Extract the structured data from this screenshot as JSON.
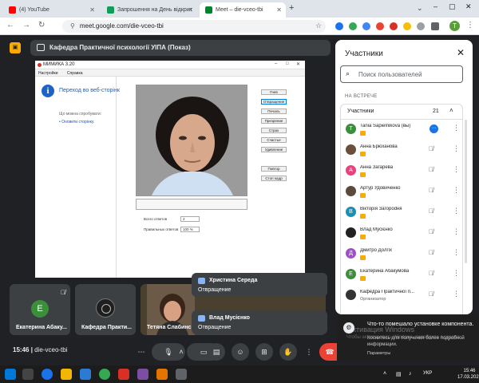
{
  "browser": {
    "tabs": [
      {
        "title": "(4) YouTube",
        "favicon_color": "#ff0000",
        "active": false
      },
      {
        "title": "Запрошення на День відкрит",
        "favicon_color": "#0f9d58",
        "active": false
      },
      {
        "title": "Meet – die-vceo-tbi",
        "favicon_color": "#00832d",
        "active": true
      }
    ],
    "url": "meet.google.com/die-vceo-tbi",
    "profile_initial": "T"
  },
  "meet": {
    "presenter_label": "Кафедра Практичної психології УІПА (Показ)",
    "meeting_code": "die-vceo-tbi",
    "time": "15:46",
    "controls": [
      "more-options",
      "mic",
      "chevron-up",
      "camera",
      "captions",
      "emoji",
      "present",
      "raise-hand",
      "more",
      "leave-call"
    ]
  },
  "shared_window": {
    "title": "МИМИКА 3.20",
    "menu": [
      "Настройки",
      "Справка"
    ],
    "error_title": "Переход во веб-сторінк",
    "error_try": "Що можна спробувати:",
    "error_refresh": "Оновити сторінку.",
    "buttons": [
      "Гнев",
      "Отвращение",
      "Печаль",
      "Презрение",
      "Страх",
      "Счастье",
      "Удивление",
      "Повтор",
      "Стоп кадр"
    ],
    "selected_button": "Отвращение",
    "stats": [
      {
        "label": "Всего ответов",
        "value": "2"
      },
      {
        "label": "Правильных ответов",
        "value": "100 %"
      }
    ]
  },
  "tiles": [
    {
      "name": "Екатерина Абаку...",
      "letter": "Е",
      "color": "#3c8f3a",
      "muted": true
    },
    {
      "name": "Кафедра Практи...",
      "emblem": true
    },
    {
      "name": "Тетяна Слабинсь...",
      "photo": true
    }
  ],
  "reactions": [
    {
      "name": "Христина Середа",
      "message": "Отвращение"
    },
    {
      "name": "Влад Мусієнко",
      "message": "Отвращение"
    }
  ],
  "panel": {
    "title": "Участники",
    "search_placeholder": "Поиск пользователей",
    "section": "НА ВСТРЕЧЕ",
    "group_label": "Участники",
    "count": "21",
    "participants": [
      {
        "name": "Tania Sapielnikova (вы)",
        "letter": "T",
        "color": "#3c8f3a",
        "speaking": true
      },
      {
        "name": "Анна Брюханова",
        "photo_color": "#6b4f3a"
      },
      {
        "name": "Анна Загарева",
        "letter": "А",
        "color": "#e8417b"
      },
      {
        "name": "Артур Удовиченко",
        "photo_color": "#5a4a3a"
      },
      {
        "name": "Вікторія Загороdня",
        "letter": "В",
        "color": "#1a8fb5"
      },
      {
        "name": "Влад Мусієнко",
        "photo_color": "#222222"
      },
      {
        "name": "Дмитро Долгіх",
        "letter": "Д",
        "color": "#9e4fc9"
      },
      {
        "name": "Екатерина Абакумова",
        "letter": "Е",
        "color": "#3c8f3a"
      },
      {
        "name": "Кафедра Практичної п...",
        "photo_color": "#333333",
        "subtitle": "Организатор"
      }
    ]
  },
  "notification": {
    "title": "Что-то помешало установке компонента.",
    "body": "Коснитесь для получения более подробной информации.",
    "footer": "Параметры",
    "watermark": "Активация Windows",
    "watermark_sub": "Чтобы активировать Windows, перейдите в раздел"
  },
  "taskbar": {
    "lang": "УКР",
    "time": "15:46",
    "date": "17.03.2025"
  }
}
